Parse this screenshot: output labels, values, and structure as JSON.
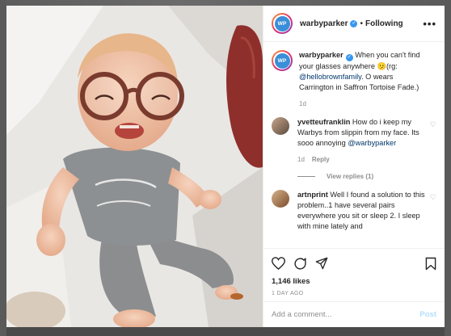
{
  "post": {
    "author": "warbyparker",
    "avatar_text": "WP",
    "follow_state": "Following",
    "more_label": "•••"
  },
  "comments": [
    {
      "user": "warbyparker",
      "parts": [
        "When you can't find your glasses anywhere ",
        "🫤",
        "(rg: ",
        "@hellobrownfamily",
        ". O wears Carrington in Saffron Tortoise Fade.)"
      ],
      "time": "1d",
      "verified": true
    },
    {
      "user": "yvetteufranklin",
      "text": "How do i keep my Warbys from slippin from my face. Its sooo annoying ",
      "mention": "@warbyparker",
      "time": "1d",
      "reply_label": "Reply",
      "view_replies": "View replies (1)"
    },
    {
      "user": "artnprint",
      "text": "Well I found a solution to this problem..1 have several pairs everywhere you sit or sleep 2. I sleep with mine lately and"
    }
  ],
  "actions": {
    "likes": "1,146 likes",
    "date": "1 DAY AGO"
  },
  "add_comment": {
    "placeholder": "Add a comment...",
    "post_label": "Post"
  },
  "colors": {
    "verified": "#3897f0",
    "mention": "#00376b",
    "post_disabled": "#b2dffc"
  }
}
